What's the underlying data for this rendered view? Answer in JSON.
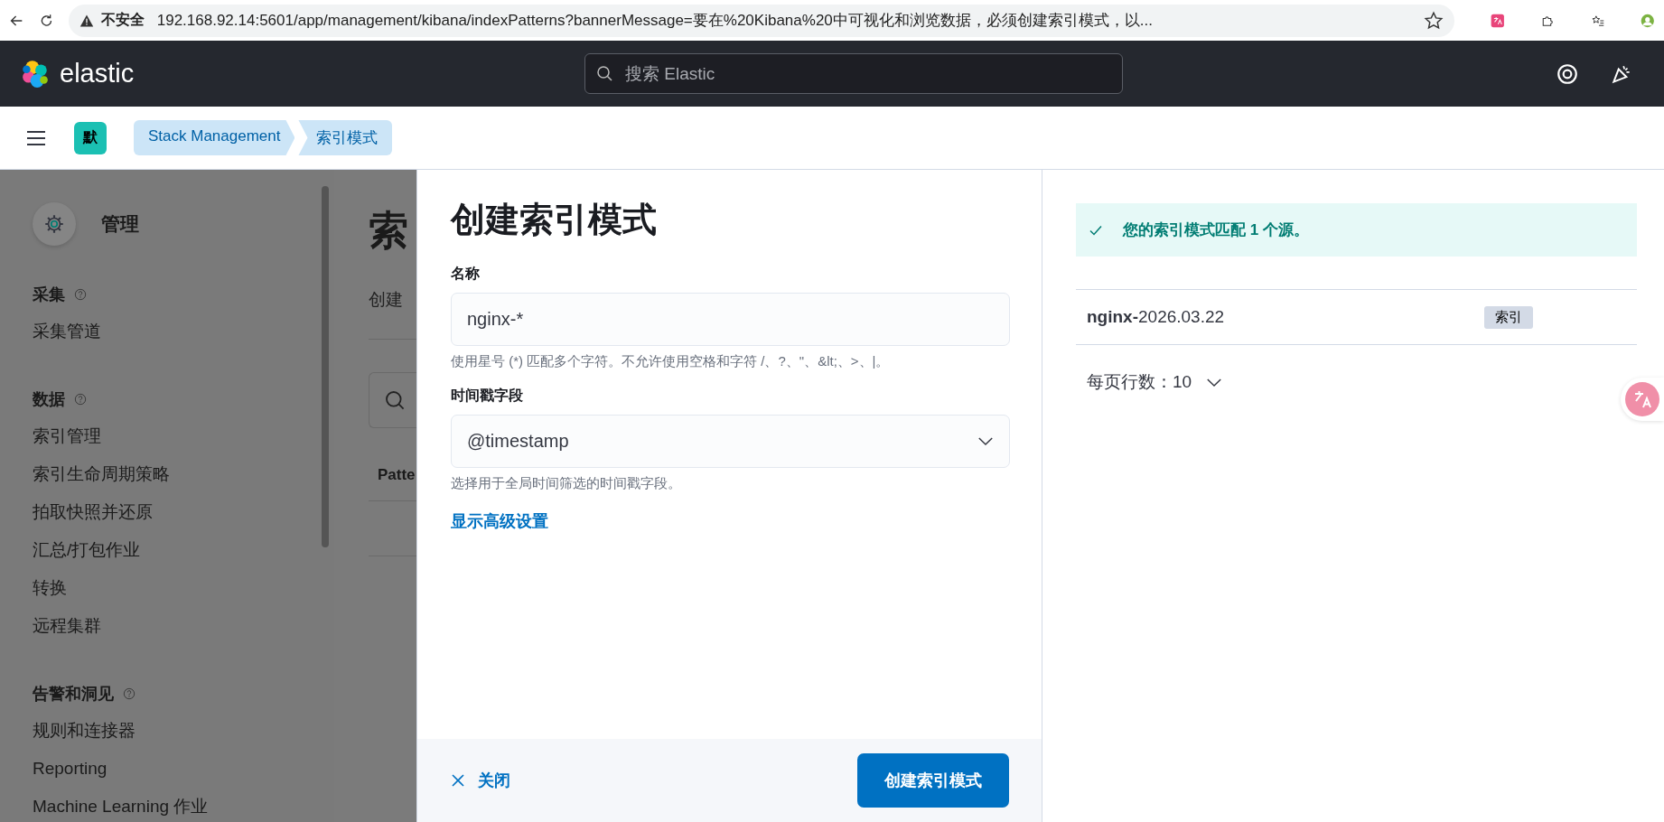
{
  "browser": {
    "security_label": "不安全",
    "url": "192.168.92.14:5601/app/management/kibana/indexPatterns?bannerMessage=要在%20Kibana%20中可视化和浏览数据，必须创建索引模式，以..."
  },
  "header": {
    "logo_text": "elastic",
    "search": {
      "placeholder": "搜索 Elastic"
    }
  },
  "breadcrumb_bar": {
    "space_badge": "默",
    "breadcrumbs": [
      {
        "label": "Stack Management"
      },
      {
        "label": "索引模式"
      }
    ]
  },
  "sidebar": {
    "title": "管理",
    "sections": [
      {
        "title": "采集",
        "items": [
          "采集管道"
        ]
      },
      {
        "title": "数据",
        "items": [
          "索引管理",
          "索引生命周期策略",
          "拍取快照并还原",
          "汇总/打包作业",
          "转换",
          "远程集群"
        ]
      },
      {
        "title": "告警和洞见",
        "items": [
          "规则和连接器",
          "Reporting",
          "Machine Learning 作业"
        ]
      }
    ]
  },
  "background_page": {
    "title": "索",
    "description": "创建",
    "table_header": "Patte"
  },
  "flyout": {
    "title": "创建索引模式",
    "name_field": {
      "label": "名称",
      "value": "nginx-*",
      "help": "使用星号 (*) 匹配多个字符。不允许使用空格和字符 /、?、\"、&lt;、>、|。"
    },
    "timestamp_field": {
      "label": "时间戳字段",
      "value": "@timestamp",
      "help": "选择用于全局时间筛选的时间戳字段。"
    },
    "advanced_link": "显示高级设置",
    "close_button": "关闭",
    "create_button": "创建索引模式",
    "callout": "您的索引模式匹配 1 个源。",
    "sources": [
      {
        "name": "**nginx-**2026.03.22",
        "tag": "索引"
      }
    ],
    "pagination": "每页行数：10"
  }
}
